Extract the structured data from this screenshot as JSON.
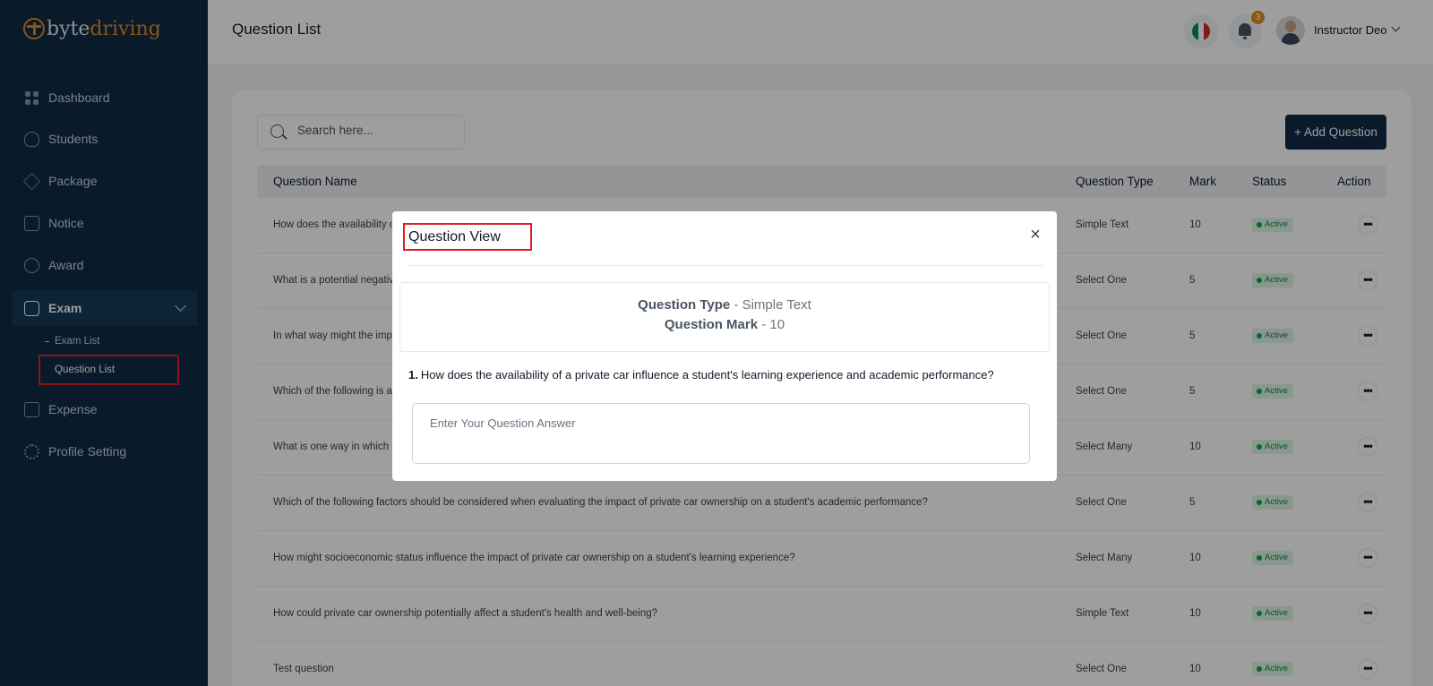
{
  "brand": {
    "part1": "byte",
    "part2": "driving"
  },
  "sidebar": {
    "items": [
      {
        "label": "Dashboard",
        "icon": "dashboard-icon"
      },
      {
        "label": "Students",
        "icon": "users-icon"
      },
      {
        "label": "Package",
        "icon": "package-icon"
      },
      {
        "label": "Notice",
        "icon": "notice-icon"
      },
      {
        "label": "Award",
        "icon": "award-icon"
      },
      {
        "label": "Exam",
        "icon": "exam-icon"
      },
      {
        "label": "Expense",
        "icon": "wallet-icon"
      },
      {
        "label": "Profile Setting",
        "icon": "gear-icon"
      }
    ],
    "exam_sub": [
      {
        "label": "Exam List"
      },
      {
        "label": "Question List"
      }
    ]
  },
  "header": {
    "title": "Question List",
    "notification_count": "3",
    "user_name": "Instructor Deo",
    "flag_colors": [
      "#009246",
      "#ffffff",
      "#ce2b37"
    ]
  },
  "toolbar": {
    "search_placeholder": "Search here...",
    "add_label": "+ Add Question"
  },
  "table": {
    "columns": [
      "Question Name",
      "Question Type",
      "Mark",
      "Status",
      "Action"
    ],
    "rows": [
      {
        "name": "How does the availability of",
        "type": "Simple Text",
        "mark": "10",
        "status": "Active"
      },
      {
        "name": "What is a potential negative",
        "type": "Select One",
        "mark": "5",
        "status": "Active"
      },
      {
        "name": "In what way might the impa",
        "type": "Select One",
        "mark": "5",
        "status": "Active"
      },
      {
        "name": "Which of the following is a p",
        "type": "Select One",
        "mark": "5",
        "status": "Active"
      },
      {
        "name": "What is one way in which p",
        "type": "Select Many",
        "mark": "10",
        "status": "Active"
      },
      {
        "name": "Which of the following factors should be considered when evaluating the impact of private car ownership on a student's academic performance?",
        "type": "Select One",
        "mark": "5",
        "status": "Active"
      },
      {
        "name": "How might socioeconomic status influence the impact of private car ownership on a student's learning experience?",
        "type": "Select Many",
        "mark": "10",
        "status": "Active"
      },
      {
        "name": "How could private car ownership potentially affect a student's health and well-being?",
        "type": "Simple Text",
        "mark": "10",
        "status": "Active"
      },
      {
        "name": "Test question",
        "type": "Select One",
        "mark": "10",
        "status": "Active"
      }
    ]
  },
  "modal": {
    "title": "Question View",
    "type_label": "Question Type",
    "type_value": "- Simple Text",
    "mark_label": "Question Mark",
    "mark_value": "- 10",
    "question_number": "1.",
    "question_text": "How does the availability of a private car influence a student's learning experience and academic performance?",
    "answer_placeholder": "Enter Your Question Answer",
    "close_glyph": "×"
  }
}
